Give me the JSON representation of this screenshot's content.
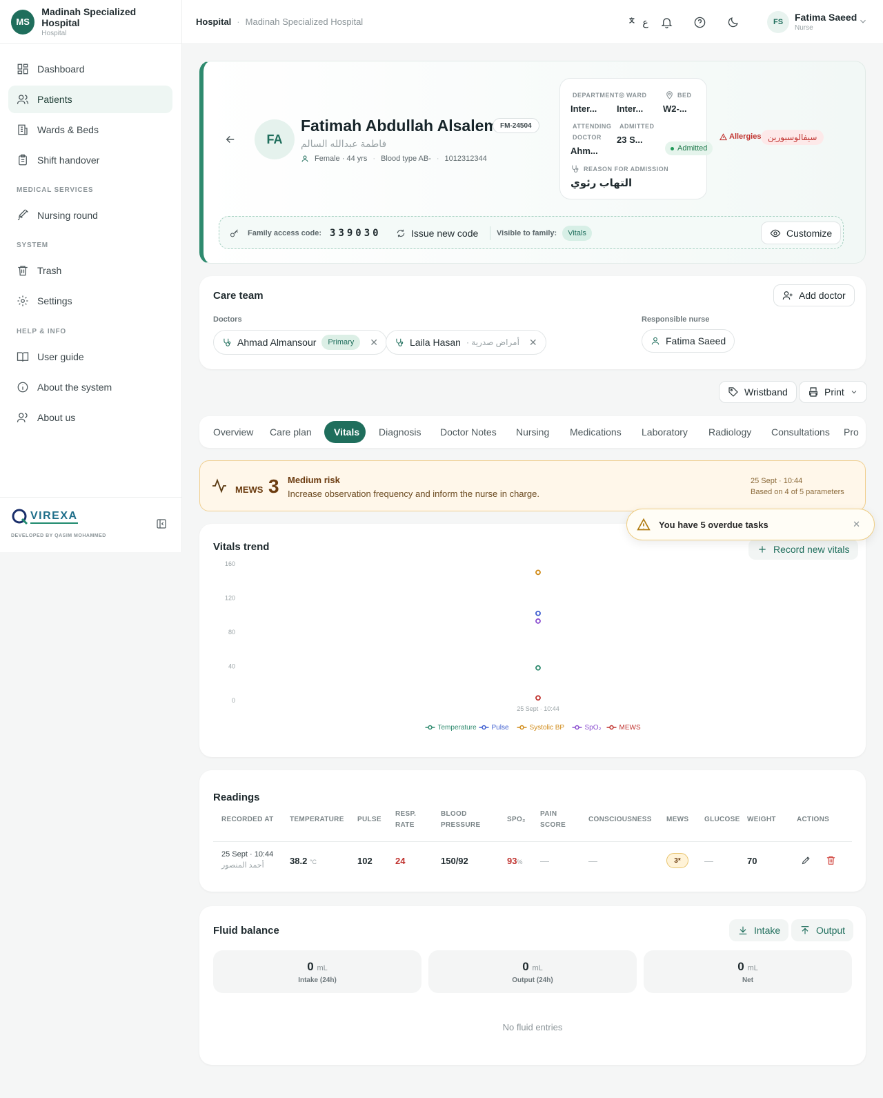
{
  "sidebar": {
    "logo_initials": "MS",
    "hospital_name": "Madinah Specialized Hospital",
    "hospital_type": "Hospital",
    "nav": [
      {
        "label": "Dashboard"
      },
      {
        "label": "Patients"
      },
      {
        "label": "Wards & Beds"
      },
      {
        "label": "Shift handover"
      }
    ],
    "section_medical": "MEDICAL SERVICES",
    "nursing_round": "Nursing round",
    "section_system": "SYSTEM",
    "trash": "Trash",
    "settings": "Settings",
    "section_help": "HELP & INFO",
    "user_guide": "User guide",
    "about_system": "About the system",
    "about_us": "About us",
    "brand": "VIREXA",
    "developed_by": "DEVELOPED BY QASIM MOHAMMED"
  },
  "topbar": {
    "crumb_1": "Hospital",
    "crumb_2": "Madinah Specialized Hospital",
    "lang_glyph": "ع",
    "user_initials": "FS",
    "user_name": "Fatima Saeed",
    "user_role": "Nurse"
  },
  "patient": {
    "initials": "FA",
    "name": "Fatimah Abdullah Alsalem",
    "id": "FM-24504",
    "name_ar": "فاطمة عبدالله السالم",
    "gender_age": "Female · 44 yrs",
    "blood_type": "Blood type AB-",
    "national_id": "1012312344",
    "department_label": "DEPARTMENT",
    "department": "Inter...",
    "ward_label": "WARD",
    "ward": "Inter...",
    "bed_label": "BED",
    "bed": "W2-...",
    "doctor_label_1": "ATTENDING",
    "doctor_label_2": "DOCTOR",
    "doctor": "Ahm...",
    "admitted_label": "ADMITTED",
    "admitted": "23 S...",
    "status": "Admitted",
    "reason_label": "REASON FOR ADMISSION",
    "reason": "التهاب رئوي",
    "allergies_label": "Allergies",
    "allergy": "سيفالوسبورين"
  },
  "family": {
    "label": "Family access code:",
    "code": "339030",
    "issue": "Issue new code",
    "visible_label": "Visible to family:",
    "visible_value": "Vitals",
    "customize": "Customize"
  },
  "care_team": {
    "title": "Care team",
    "add_doctor": "Add doctor",
    "doctors_label": "Doctors",
    "doctor_1": "Ahmad Almansour",
    "doctor_1_badge": "Primary",
    "doctor_2": "Laila Hasan",
    "doctor_2_spec": "· أمراض صدرية",
    "nurse_label": "Responsible nurse",
    "nurse": "Fatima Saeed"
  },
  "actions": {
    "wristband": "Wristband",
    "print": "Print"
  },
  "tabs": [
    "Overview",
    "Care plan",
    "Vitals",
    "Diagnosis",
    "Doctor Notes",
    "Nursing",
    "Medications",
    "Laboratory",
    "Radiology",
    "Consultations",
    "Pro"
  ],
  "mews": {
    "label": "MEWS",
    "score": "3",
    "risk": "Medium risk",
    "advice": "Increase observation frequency and inform the nurse in charge.",
    "time": "25 Sept · 10:44",
    "basis": "Based on 4 of 5 parameters"
  },
  "toast": {
    "text": "You have 5 overdue tasks"
  },
  "vitals": {
    "title": "Vitals trend",
    "record_button": "Record new vitals"
  },
  "chart_data": {
    "type": "scatter",
    "x": [
      "25 Sept · 10:44"
    ],
    "ylim": [
      0,
      160
    ],
    "yticks": [
      160,
      120,
      80,
      40,
      0
    ],
    "series": [
      {
        "name": "Temperature",
        "color": "#2e8a6e",
        "values": [
          38.2
        ]
      },
      {
        "name": "Pulse",
        "color": "#3f5fd0",
        "values": [
          102
        ]
      },
      {
        "name": "Systolic BP",
        "color": "#d08a17",
        "values": [
          150
        ]
      },
      {
        "name": "SpO₂",
        "color": "#8b4fd0",
        "values": [
          93
        ]
      },
      {
        "name": "MEWS",
        "color": "#c0322e",
        "values": [
          3
        ]
      }
    ],
    "legend": "bottom",
    "grid": false
  },
  "readings": {
    "title": "Readings",
    "headers": [
      "RECORDED AT",
      "TEMPERATURE",
      "PULSE",
      "RESP.\nRATE",
      "BLOOD\nPRESSURE",
      "SPO₂",
      "PAIN\nSCORE",
      "CONSCIOUSNESS",
      "MEWS",
      "GLUCOSE",
      "WEIGHT",
      "ACTIONS"
    ],
    "row": {
      "recorded_at": "25 Sept · 10:44",
      "recorded_by": "أحمد المنصور",
      "temperature": "38.2",
      "temp_unit": "°C",
      "pulse": "102",
      "resp_rate": "24",
      "blood_pressure": "150/92",
      "spo2": "93",
      "spo2_unit": "%",
      "pain": "—",
      "consciousness": "—",
      "mews": "3*",
      "glucose": "—",
      "weight": "70"
    }
  },
  "fluid": {
    "title": "Fluid balance",
    "intake_btn": "Intake",
    "output_btn": "Output",
    "intake_value": "0",
    "output_value": "0",
    "net_value": "0",
    "unit": "mL",
    "intake_label": "Intake (24h)",
    "output_label": "Output (24h)",
    "net_label": "Net",
    "empty": "No fluid entries"
  }
}
